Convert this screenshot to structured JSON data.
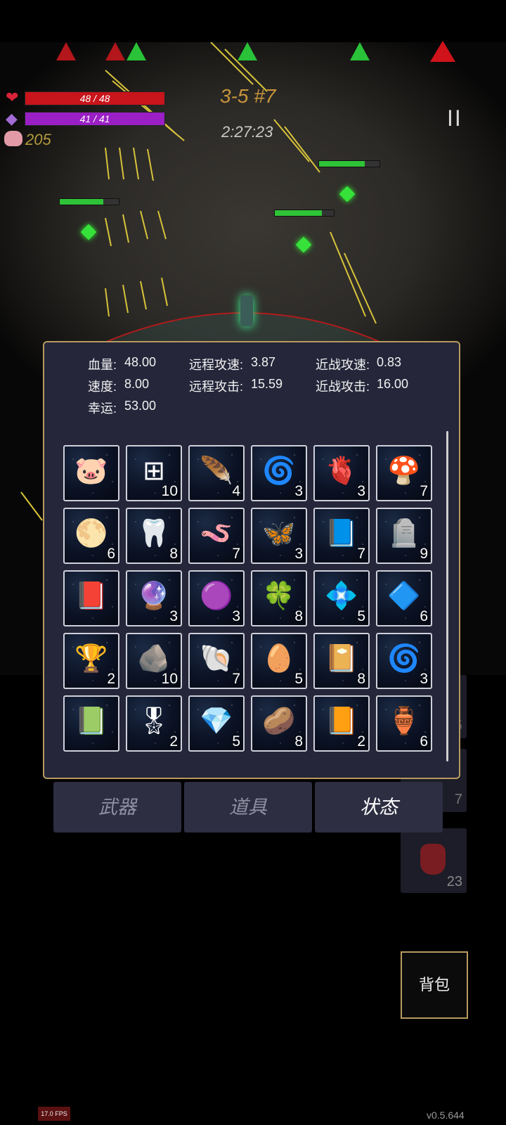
{
  "hud": {
    "hp_text": "48 / 48",
    "mp_text": "41 / 41",
    "gold": "205",
    "stage": "3-5 #7",
    "timer": "2:27:23",
    "pause_glyph": "II"
  },
  "stats": {
    "hp_label": "血量:",
    "hp_value": "48.00",
    "speed_label": "速度:",
    "speed_value": "8.00",
    "luck_label": "幸运:",
    "luck_value": "53.00",
    "ranged_speed_label": "远程攻速:",
    "ranged_speed_value": "3.87",
    "ranged_attack_label": "远程攻击:",
    "ranged_attack_value": "15.59",
    "melee_speed_label": "近战攻速:",
    "melee_speed_value": "0.83",
    "melee_attack_label": "近战攻击:",
    "melee_attack_value": "16.00"
  },
  "items": [
    {
      "icon": "piggy-bank-icon",
      "glyph": "🐷",
      "count": ""
    },
    {
      "icon": "medkit-icon",
      "glyph": "⊞",
      "count": "10"
    },
    {
      "icon": "feather-icon",
      "glyph": "🪶",
      "count": "4"
    },
    {
      "icon": "spiral-rune-icon",
      "glyph": "🌀",
      "count": "3"
    },
    {
      "icon": "burning-heart-icon",
      "glyph": "🫀",
      "count": "3"
    },
    {
      "icon": "mushroom-icon",
      "glyph": "🍄",
      "count": "7"
    },
    {
      "icon": "sun-orb-icon",
      "glyph": "🌕",
      "count": "6"
    },
    {
      "icon": "horn-icon",
      "glyph": "🦷",
      "count": "8"
    },
    {
      "icon": "worm-icon",
      "glyph": "🪱",
      "count": "7"
    },
    {
      "icon": "dragonfly-icon",
      "glyph": "🦋",
      "count": "3"
    },
    {
      "icon": "blue-tome-icon",
      "glyph": "📘",
      "count": "7"
    },
    {
      "icon": "gravestone-icon",
      "glyph": "🪦",
      "count": "9"
    },
    {
      "icon": "dark-grimoire-icon",
      "glyph": "📕",
      "count": ""
    },
    {
      "icon": "purple-rune-icon",
      "glyph": "🔮",
      "count": "3"
    },
    {
      "icon": "pink-slime-icon",
      "glyph": "🟣",
      "count": "3"
    },
    {
      "icon": "clover-icon",
      "glyph": "🍀",
      "count": "8"
    },
    {
      "icon": "crystal-cluster-icon",
      "glyph": "💠",
      "count": "5"
    },
    {
      "icon": "diamond-crystal-icon",
      "glyph": "🔷",
      "count": "6"
    },
    {
      "icon": "star-trophy-icon",
      "glyph": "🏆",
      "count": "2"
    },
    {
      "icon": "ore-chunk-icon",
      "glyph": "🪨",
      "count": "10"
    },
    {
      "icon": "purple-shell-icon",
      "glyph": "🐚",
      "count": "7"
    },
    {
      "icon": "egg-icon",
      "glyph": "🥚",
      "count": "5"
    },
    {
      "icon": "magenta-book-icon",
      "glyph": "📔",
      "count": "8"
    },
    {
      "icon": "spiral-rune-icon",
      "glyph": "🌀",
      "count": "3"
    },
    {
      "icon": "blue-spellbook-icon",
      "glyph": "📗",
      "count": ""
    },
    {
      "icon": "medal-icon",
      "glyph": "🎖",
      "count": "2"
    },
    {
      "icon": "blue-stone-icon",
      "glyph": "💎",
      "count": "5"
    },
    {
      "icon": "pebbles-icon",
      "glyph": "🥔",
      "count": "8"
    },
    {
      "icon": "gold-book-icon",
      "glyph": "📙",
      "count": "2"
    },
    {
      "icon": "vase-icon",
      "glyph": "🏺",
      "count": "6"
    }
  ],
  "tabs": {
    "weapons": "武器",
    "items": "道具",
    "status": "状态"
  },
  "side_counts": {
    "a": "5",
    "b": "7",
    "potion": "23"
  },
  "backpack": "背包",
  "fps": "17.0 FPS",
  "version": "v0.5.644",
  "colors": {
    "hp": "#c8141b",
    "mp": "#9a1fc4",
    "accent_gold": "#b79a5e",
    "panel": "#25263a"
  }
}
